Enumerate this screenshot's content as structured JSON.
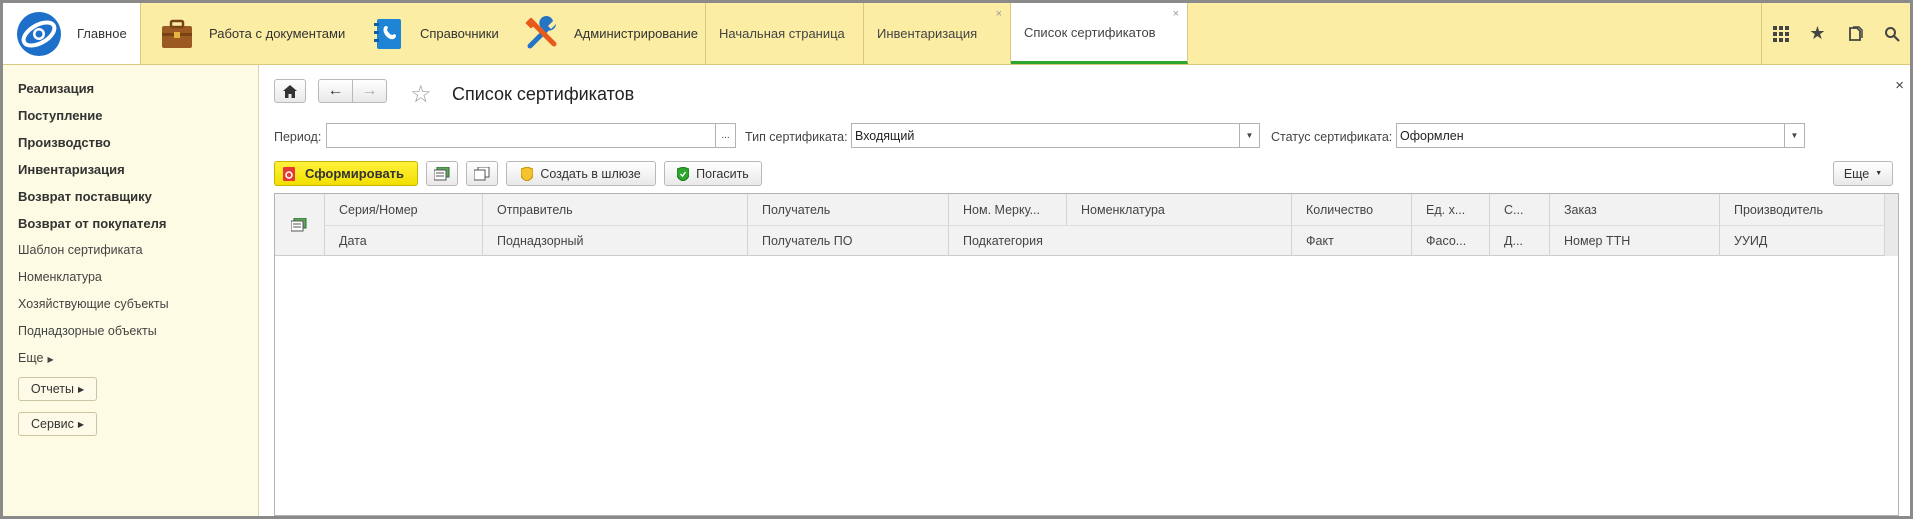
{
  "topbar": {
    "home_label": "Главное",
    "sections": [
      {
        "label": "Работа с документами",
        "icon": "briefcase-icon"
      },
      {
        "label": "Справочники",
        "icon": "phonebook-icon"
      },
      {
        "label": "Администрирование",
        "icon": "tools-icon"
      }
    ],
    "tabs": [
      {
        "label": "Начальная страница"
      },
      {
        "label": "Инвентаризация",
        "close": "×"
      },
      {
        "label": "Список сертификатов",
        "close": "×"
      }
    ],
    "right_icons": [
      "apps-grid-icon",
      "favorites-star-icon",
      "history-icon",
      "search-icon"
    ]
  },
  "sidebar": {
    "items": [
      "Реализация",
      "Поступление",
      "Производство",
      "Инвентаризация",
      "Возврат поставщику",
      "Возврат от покупателя",
      "Шаблон сертификата",
      "Номенклатура",
      "Хозяйствующие субъекты",
      "Поднадзорные объекты",
      "Еще"
    ],
    "reports_label": "Отчеты",
    "service_label": "Сервис"
  },
  "form": {
    "title": "Список сертификатов",
    "period_label": "Период:",
    "period_value": "",
    "period_select": "...",
    "type_label": "Тип сертификата:",
    "type_value": "Входящий",
    "status_label": "Статус сертификата:",
    "status_value": "Оформлен",
    "generate_label": "Сформировать",
    "create_gateway_label": "Создать в шлюзе",
    "redeem_label": "Погасить",
    "more_label": "Еще",
    "close": "×"
  },
  "table": {
    "row1": [
      "Серия/Номер",
      "Отправитель",
      "Получатель",
      "Ном. Мерку...",
      "Номенклатура",
      "Количество",
      "Ед. х...",
      "С...",
      "Заказ",
      "Производитель"
    ],
    "row2": [
      "Дата",
      "Поднадзорный",
      "Получатель ПО",
      "Подкатегория",
      "Факт",
      "Фасо...",
      "Д...",
      "Номер ТТН",
      "УУИД"
    ]
  },
  "colors": {
    "topbar_bg": "#fbeda4",
    "sidebar_bg": "#fdfbe3",
    "accent_yellow": "#f7e600",
    "active_tab_underline": "#2ea52e"
  }
}
